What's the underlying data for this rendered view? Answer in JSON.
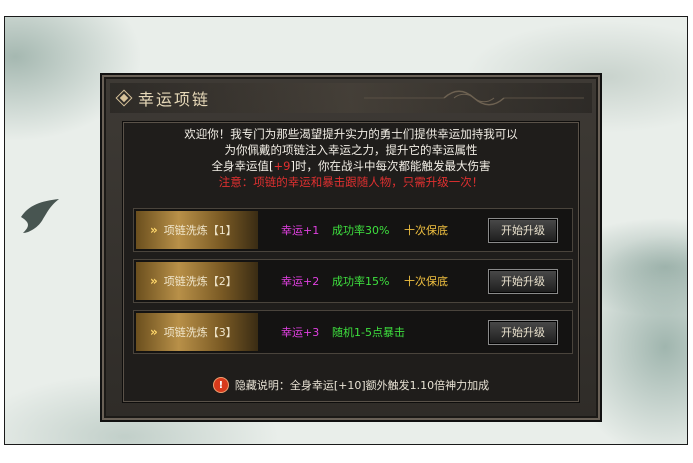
{
  "window": {
    "title": "幸运项链"
  },
  "intro": {
    "line1": "欢迎你！我专门为那些渴望提升实力的勇士们提供幸运加持我可以",
    "line2": "为你佩戴的项链注入幸运之力，提升它的幸运属性",
    "line3_prefix": "全身幸运值[",
    "line3_value": "+9",
    "line3_suffix": "]时，你在战斗中每次都能触发最大伤害",
    "warning": "注意：项链的幸运和暴击跟随人物，只需升级一次！"
  },
  "upgrades": [
    {
      "label": "项链洗炼【1】",
      "luck": "幸运+1",
      "rate": "成功率30%",
      "guarantee": "十次保底",
      "button": "开始升级"
    },
    {
      "label": "项链洗炼【2】",
      "luck": "幸运+2",
      "rate": "成功率15%",
      "guarantee": "十次保底",
      "button": "开始升级"
    },
    {
      "label": "项链洗炼【3】",
      "luck": "幸运+3",
      "rate": "随机1-5点暴击",
      "guarantee": "",
      "button": "开始升级"
    }
  ],
  "footer": {
    "text": "隐藏说明：全身幸运[+10]额外触发1.10倍神力加成",
    "icon": "alert-icon"
  },
  "colors": {
    "luck": "#e040e0",
    "rate": "#3ee03e",
    "guarantee": "#f0c040",
    "warning": "#e03030"
  }
}
